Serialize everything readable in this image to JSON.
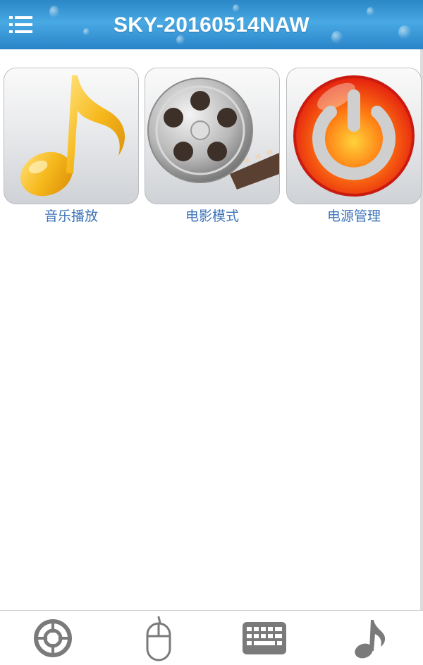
{
  "header": {
    "title": "SKY-20160514NAW",
    "menu_icon": "menu-list-icon"
  },
  "tiles": [
    {
      "label": "音乐播放",
      "icon": "music-note-icon"
    },
    {
      "label": "电影模式",
      "icon": "film-reel-icon"
    },
    {
      "label": "电源管理",
      "icon": "power-icon"
    }
  ],
  "bottom_nav": [
    {
      "icon": "remote-dpad-icon"
    },
    {
      "icon": "mouse-icon"
    },
    {
      "icon": "keyboard-icon"
    },
    {
      "icon": "music-note-icon"
    }
  ],
  "colors": {
    "header_blue": "#2b86c6",
    "label_blue": "#3e74b8",
    "power_red": "#e8281b",
    "music_gold": "#f4b21a",
    "nav_gray": "#7a7a7a"
  }
}
